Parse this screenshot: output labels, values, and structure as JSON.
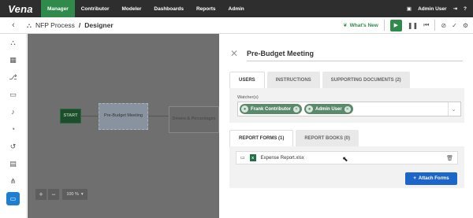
{
  "app": {
    "logo": "Vena"
  },
  "topnav": {
    "items": [
      {
        "label": "Manager",
        "active": true
      },
      {
        "label": "Contributor",
        "active": false
      },
      {
        "label": "Modeler",
        "active": false
      },
      {
        "label": "Dashboards",
        "active": false
      },
      {
        "label": "Reports",
        "active": false
      },
      {
        "label": "Admin",
        "active": false
      }
    ],
    "user": "Admin User"
  },
  "subheader": {
    "crumb_process": "NFP Process",
    "separator": "/",
    "crumb_page": "Designer",
    "whats_new": "What's New"
  },
  "canvas": {
    "nodes": [
      {
        "label": "START"
      },
      {
        "label": "Pre-Budget Meeting"
      },
      {
        "label": "Drivers & Percentages"
      }
    ],
    "zoom_level": "100 %"
  },
  "panel": {
    "title": "Pre-Budget Meeting",
    "tabs": [
      {
        "label": "USERS",
        "active": true
      },
      {
        "label": "INSTRUCTIONS",
        "active": false
      },
      {
        "label": "SUPPORTING DOCUMENTS (2)",
        "active": false
      }
    ],
    "watchers_label": "Watcher(s)",
    "watchers": [
      {
        "name": "Frank Contributor"
      },
      {
        "name": "Admin User"
      }
    ],
    "report_tabs": [
      {
        "label": "REPORT FORMS (1)",
        "active": true
      },
      {
        "label": "REPORT BOOKS (0)",
        "active": false
      }
    ],
    "report_forms": [
      {
        "file": "Expense Report.xlsx"
      }
    ],
    "attach_button": "Attach Forms"
  },
  "colors": {
    "accent_green": "#2f8a4c",
    "topbar": "#2e2e2e",
    "primary_blue": "#1c66c9"
  }
}
